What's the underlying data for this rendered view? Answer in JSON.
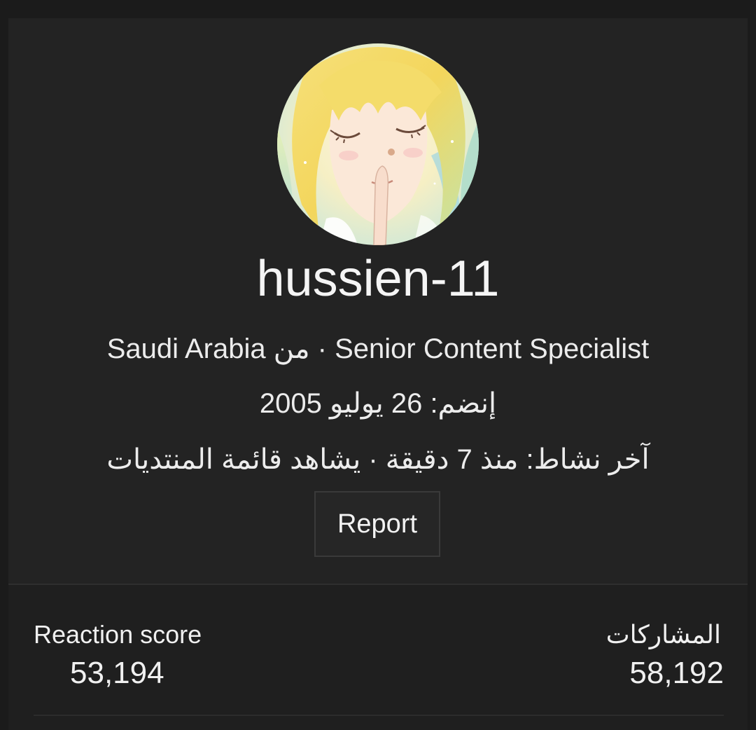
{
  "profile": {
    "avatar_alt": "avatar",
    "username": "hussien-11",
    "title_line": "Saudi Arabia من · Senior Content Specialist",
    "joined_line": "إنضم: 26 يوليو 2005",
    "activity_line": "آخر نشاط: منذ 7 دقيقة · يشاهد قائمة المنتديات",
    "report_label": "Report"
  },
  "stats": {
    "reaction_label": "Reaction score",
    "reaction_value": "53,194",
    "posts_label": "المشاركات",
    "posts_value": "58,192"
  },
  "colors": {
    "background": "#1b1b1b",
    "card": "#232323",
    "stats_panel": "#1f1f1f",
    "text": "#f2f2f2",
    "button_border": "#3a3a3a"
  }
}
